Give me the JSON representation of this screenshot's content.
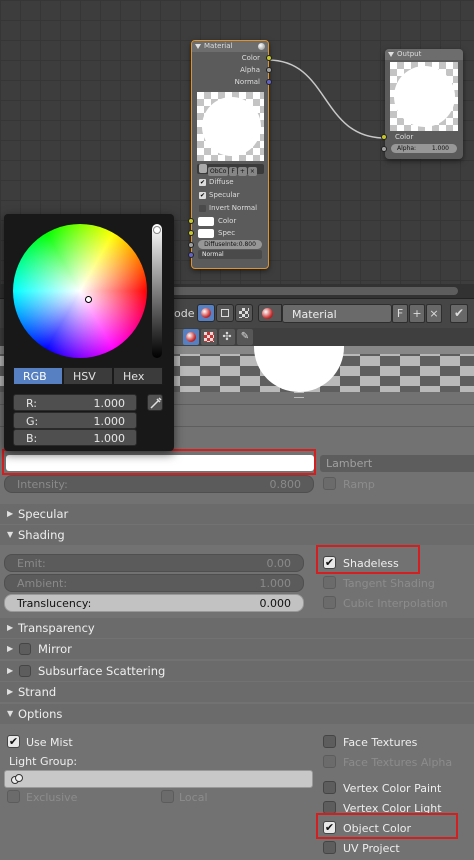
{
  "node_editor": {
    "material_node": {
      "title": "Material",
      "outputs": [
        "Color",
        "Alpha",
        "Normal"
      ],
      "mat_buttons": [
        "ObCo",
        "F"
      ],
      "checks": [
        {
          "label": "Diffuse",
          "checked": true
        },
        {
          "label": "Specular",
          "checked": true
        },
        {
          "label": "Invert Normal",
          "checked": false
        }
      ],
      "inputs": [
        "Color",
        "Spec"
      ],
      "diffuse_field": "DiffuseInte:0.800",
      "normal_dropdown": "Normal"
    },
    "output_node": {
      "title": "Output",
      "inputs": [
        "Color"
      ],
      "alpha_label": "Alpha:",
      "alpha_value": "1.000"
    }
  },
  "header": {
    "mode_partial": "ode",
    "material_name": "Material",
    "fake_user": "F"
  },
  "color_picker": {
    "tabs": [
      "RGB",
      "HSV",
      "Hex"
    ],
    "selected_tab": "RGB",
    "channels": [
      {
        "label": "R:",
        "value": "1.000"
      },
      {
        "label": "G:",
        "value": "1.000"
      },
      {
        "label": "B:",
        "value": "1.000"
      }
    ]
  },
  "diffuse": {
    "color_hex": "#ffffff",
    "shader": "Lambert",
    "intensity_label": "Intensity:",
    "intensity_value": "0.800",
    "ramp_label": "Ramp"
  },
  "panels": {
    "specular": "Specular",
    "shading": "Shading",
    "transparency": "Transparency",
    "mirror": "Mirror",
    "sss": "Subsurface Scattering",
    "strand": "Strand",
    "options": "Options"
  },
  "shading": {
    "emit_label": "Emit:",
    "emit_value": "0.00",
    "ambient_label": "Ambient:",
    "ambient_value": "1.000",
    "translucency_label": "Translucency:",
    "translucency_value": "0.000",
    "shadeless": "Shadeless",
    "tangent_shading": "Tangent Shading",
    "cubic_interpolation": "Cubic Interpolation"
  },
  "options": {
    "use_mist": "Use Mist",
    "light_group_label": "Light Group:",
    "exclusive": "Exclusive",
    "local": "Local",
    "face_textures": "Face Textures",
    "face_textures_alpha": "Face Textures Alpha",
    "vertex_color_paint": "Vertex Color Paint",
    "vertex_color_light": "Vertex Color Light",
    "object_color": "Object Color",
    "uv_project": "UV Project"
  },
  "colors": {
    "highlight_red": "#d31f1f",
    "accent_blue": "#5680c2"
  }
}
